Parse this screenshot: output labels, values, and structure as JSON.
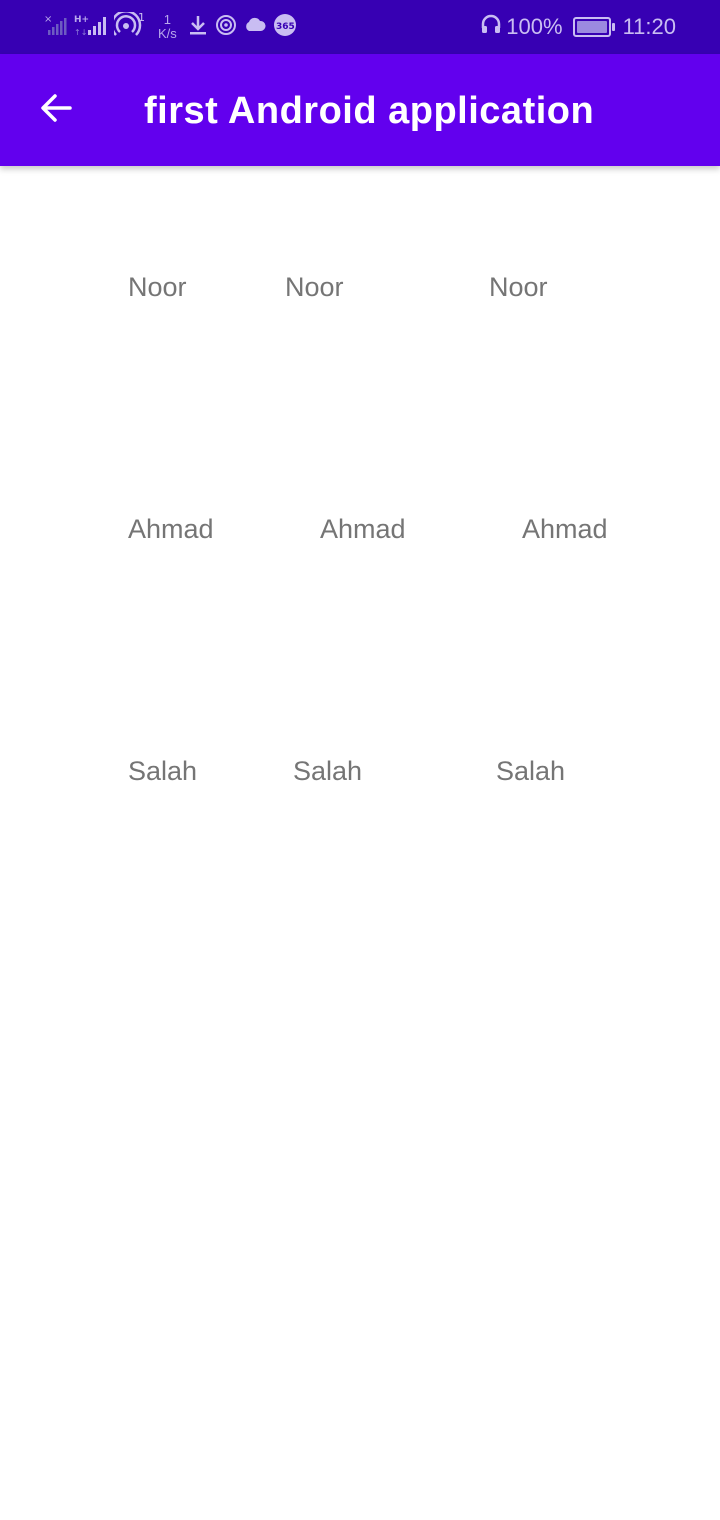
{
  "status_bar": {
    "net_speed_value": "1",
    "net_speed_unit": "K/s",
    "hotspot_count": "1",
    "battery": "100%",
    "battery_level_percent": 100,
    "time": "11:20",
    "icons": [
      "no-sim-signal-icon",
      "hplus-signal-icon",
      "hotspot-icon",
      "download-icon",
      "wifi-calling-icon",
      "cloud-icon",
      "app-365-icon",
      "headphones-icon",
      "battery-charging-icon"
    ]
  },
  "app_bar": {
    "title": "first Android application",
    "back_icon": "arrow-back-icon"
  },
  "grid": {
    "rows": [
      {
        "cells": [
          "Noor",
          "Noor",
          "Noor"
        ]
      },
      {
        "cells": [
          "Ahmad",
          "Ahmad",
          "Ahmad"
        ]
      },
      {
        "cells": [
          "Salah",
          "Salah",
          "Salah"
        ]
      }
    ]
  },
  "colors": {
    "status_bar": "#3700b3",
    "app_bar": "#6200ee",
    "text_secondary": "#757575",
    "background": "#ffffff"
  }
}
